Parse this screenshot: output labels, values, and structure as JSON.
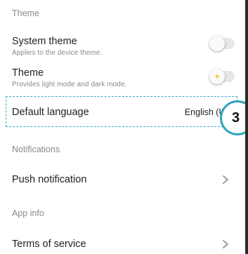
{
  "settings": {
    "theme_section": {
      "header": "Theme",
      "system_theme": {
        "title": "System theme",
        "subtitle": "Applies to the device theme.",
        "enabled": false
      },
      "theme": {
        "title": "Theme",
        "subtitle": "Provides light mode and dark mode.",
        "enabled": false,
        "knob_icon": "sun-icon"
      }
    },
    "language": {
      "label": "Default language",
      "value": "English (US)",
      "step_marker": "3"
    },
    "notifications_section": {
      "header": "Notifications",
      "push": {
        "title": "Push notification",
        "icon": "chevron-right-icon"
      }
    },
    "app_info_section": {
      "header": "App info",
      "terms": {
        "title": "Terms of service",
        "icon": "chevron-right-icon"
      }
    }
  },
  "colors": {
    "highlight": "#2ea3c0",
    "sun": "#f5c542",
    "secondary_text": "#8a8a8a"
  }
}
